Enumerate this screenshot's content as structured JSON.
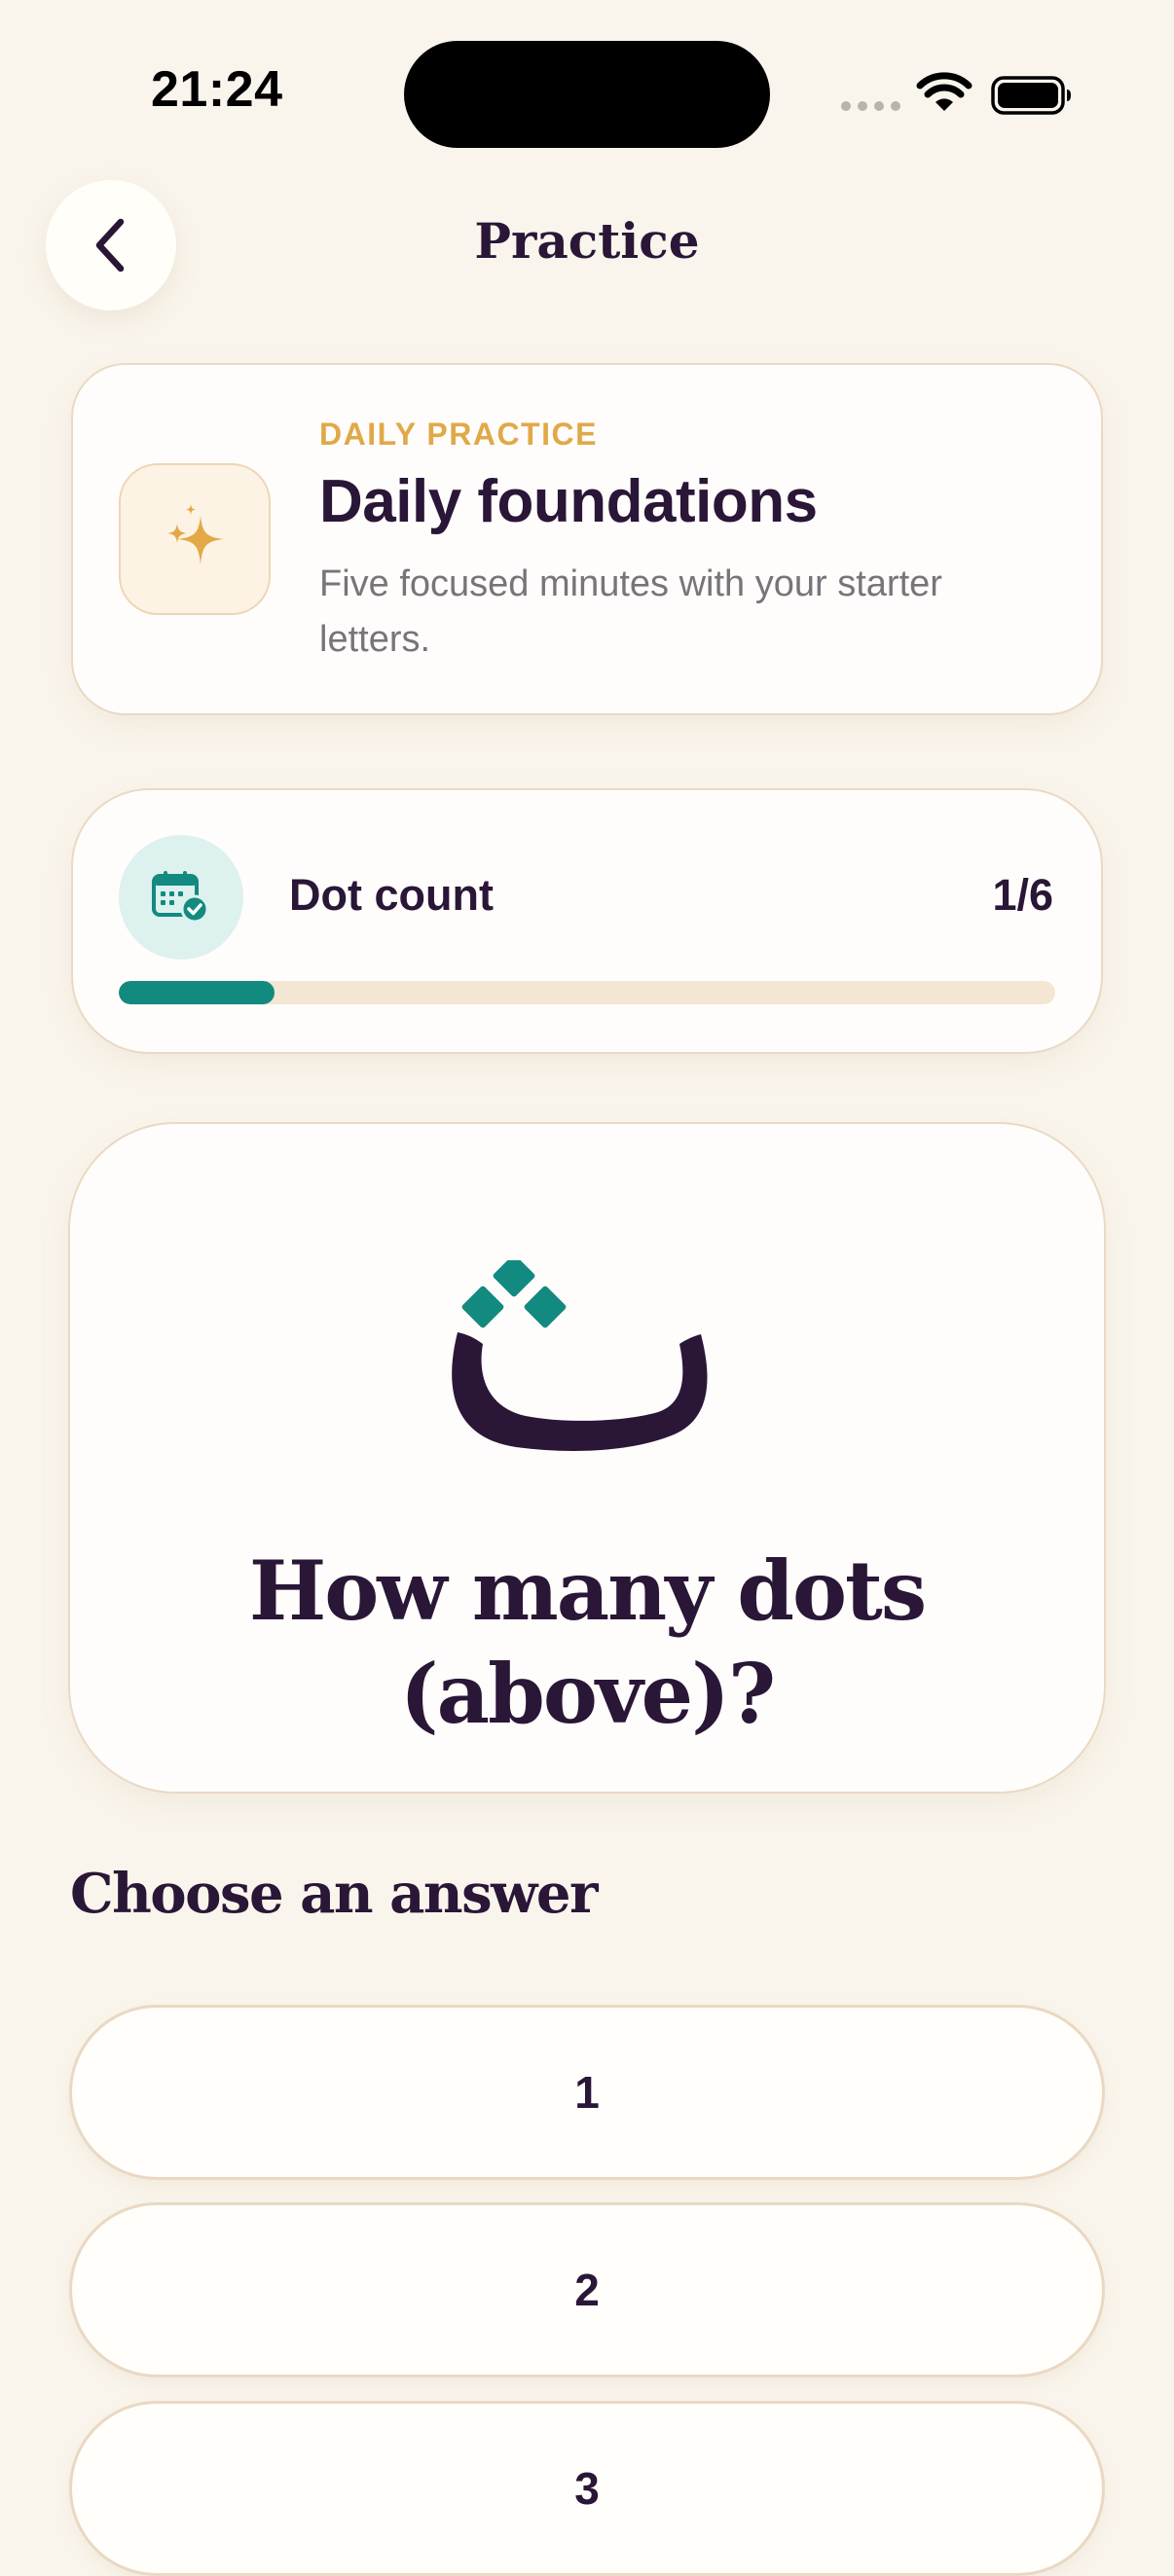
{
  "status_bar": {
    "time": "21:24"
  },
  "header": {
    "back_icon": "chevron-left-icon",
    "title": "Practice"
  },
  "daily_card": {
    "icon": "sparkles-icon",
    "tag": "DAILY PRACTICE",
    "title": "Daily foundations",
    "subtitle": "Five focused minutes with your starter letters."
  },
  "progress": {
    "icon": "calendar-check-icon",
    "label": "Dot count",
    "count": "1/6",
    "fraction": 0.1667
  },
  "question": {
    "letter": "ث",
    "text": "How many dots (above)?"
  },
  "answers": {
    "heading": "Choose an answer",
    "options": [
      "1",
      "2",
      "3"
    ]
  },
  "colors": {
    "background": "#FAF5EC",
    "ink": "#2A1637",
    "accent_gold": "#E0A948",
    "accent_teal": "#128A80"
  }
}
